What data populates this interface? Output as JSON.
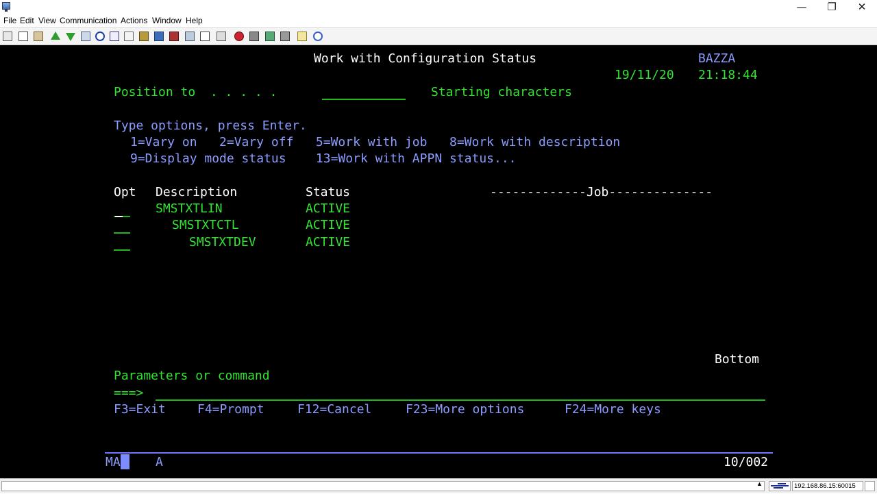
{
  "window": {
    "minimize": "—",
    "restore": "❐",
    "close": "✕"
  },
  "menu": [
    "File",
    "Edit",
    "View",
    "Communication",
    "Actions",
    "Window",
    "Help"
  ],
  "toolbar_icons": [
    "copy-screen-icon",
    "copy-icon",
    "paste-icon",
    "send-file-icon",
    "receive-file-icon",
    "print-icon",
    "record-icon",
    "display-icon",
    "keypad-icon",
    "macro-icon",
    "play-macro-icon",
    "keyboard-icon",
    "calculator-icon",
    "customize-icon",
    "disconnect-icon",
    "connect-icon",
    "transfer-icon",
    "stop-icon",
    "notes-icon",
    "help-icon"
  ],
  "screen": {
    "title": "Work with Configuration Status",
    "system": "BAZZA",
    "date": "19/11/20",
    "time": "21:18:44",
    "position_label": "Position to  . . . . .",
    "position_value": "",
    "position_hint": "Starting characters",
    "instructions": "Type options, press Enter.",
    "options_row1": "1=Vary on   2=Vary off   5=Work with job   8=Work with description",
    "options_row2": "9=Display mode status    13=Work with APPN status...",
    "col_opt": "Opt",
    "col_description": "Description",
    "col_status": "Status",
    "col_job": "-------------Job--------------",
    "rows": [
      {
        "opt": "",
        "description": "SMSTXTLIN",
        "status": "ACTIVE"
      },
      {
        "opt": "",
        "description": "SMSTXTCTL",
        "status": "ACTIVE"
      },
      {
        "opt": "",
        "description": "SMSTXTDEV",
        "status": "ACTIVE"
      }
    ],
    "more_indicator": "Bottom",
    "params_label": "Parameters or command",
    "prompt": "===>",
    "command_value": "",
    "function_keys": [
      "F3=Exit",
      "F4=Prompt",
      "F12=Cancel",
      "F23=More options",
      "F24=More keys"
    ]
  },
  "oia": {
    "session": "MA",
    "session_type": "A",
    "cursor_position": "10/002"
  },
  "statusbar": {
    "host": "192.168.86.15:60015"
  }
}
